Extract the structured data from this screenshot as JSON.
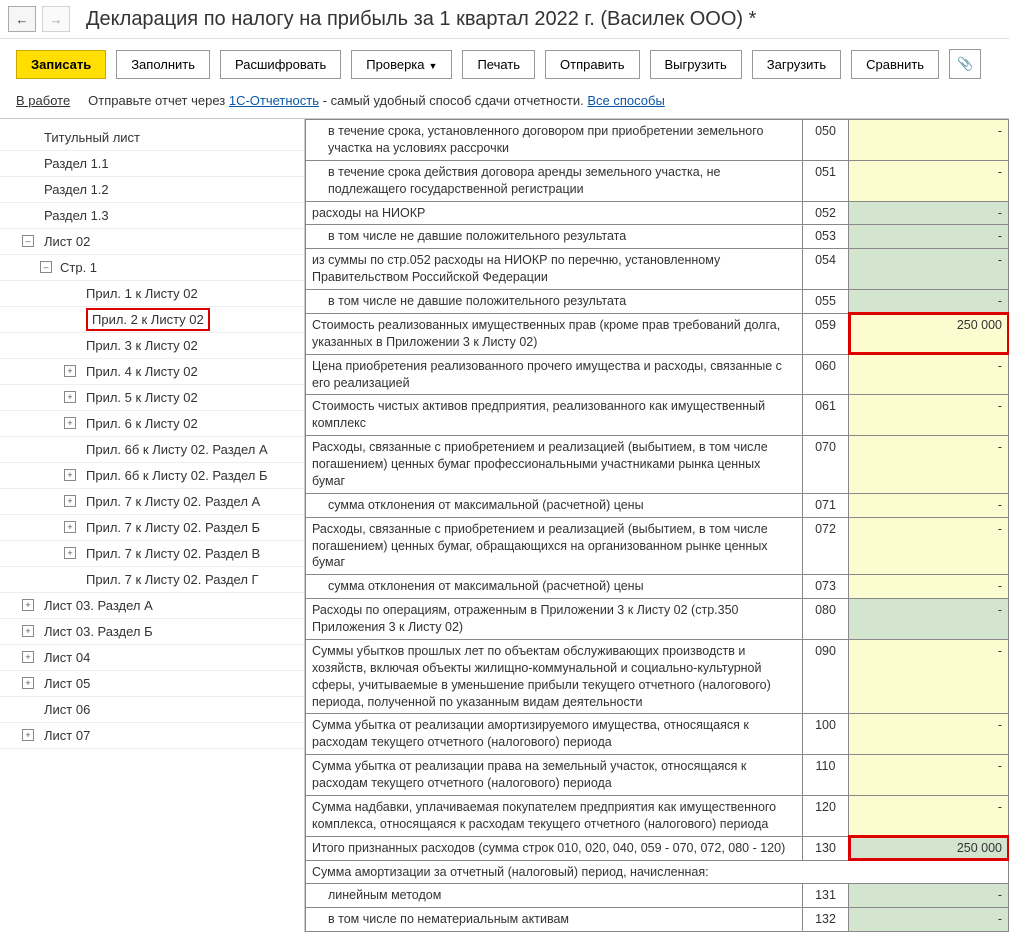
{
  "header": {
    "title": "Декларация по налогу на прибыль за 1 квартал 2022 г. (Василек ООО) *"
  },
  "toolbar": {
    "save": "Записать",
    "fill": "Заполнить",
    "decode": "Расшифровать",
    "check": "Проверка",
    "print": "Печать",
    "send": "Отправить",
    "upload": "Выгрузить",
    "download": "Загрузить",
    "compare": "Сравнить"
  },
  "status": {
    "label": "В работе",
    "text1": "Отправьте отчет через ",
    "link1": "1С-Отчетность",
    "text2": " - самый удобный способ сдачи отчетности. ",
    "link2": "Все способы"
  },
  "tree": [
    {
      "lvl": 0,
      "label": "Титульный лист",
      "exp": ""
    },
    {
      "lvl": 0,
      "label": "Раздел 1.1",
      "exp": ""
    },
    {
      "lvl": 0,
      "label": "Раздел 1.2",
      "exp": ""
    },
    {
      "lvl": 0,
      "label": "Раздел 1.3",
      "exp": ""
    },
    {
      "lvl": 0,
      "label": "Лист 02",
      "exp": "–"
    },
    {
      "lvl": 1,
      "label": "Стр. 1",
      "exp": "–"
    },
    {
      "lvl": 2,
      "label": "Прил. 1 к Листу 02",
      "exp": ""
    },
    {
      "lvl": 2,
      "label": "Прил. 2 к Листу 02",
      "exp": "",
      "hl": true
    },
    {
      "lvl": 2,
      "label": "Прил. 3 к Листу 02",
      "exp": ""
    },
    {
      "lvl": 2,
      "label": "Прил. 4 к Листу 02",
      "exp": "+"
    },
    {
      "lvl": 2,
      "label": "Прил. 5 к Листу 02",
      "exp": "+"
    },
    {
      "lvl": 2,
      "label": "Прил. 6 к Листу 02",
      "exp": "+"
    },
    {
      "lvl": 2,
      "label": "Прил. 6б к Листу 02. Раздел А",
      "exp": ""
    },
    {
      "lvl": 2,
      "label": "Прил. 6б к Листу 02. Раздел Б",
      "exp": "+"
    },
    {
      "lvl": 2,
      "label": "Прил. 7 к Листу 02. Раздел А",
      "exp": "+"
    },
    {
      "lvl": 2,
      "label": "Прил. 7 к Листу 02. Раздел Б",
      "exp": "+"
    },
    {
      "lvl": 2,
      "label": "Прил. 7 к Листу 02. Раздел В",
      "exp": "+"
    },
    {
      "lvl": 2,
      "label": "Прил. 7 к Листу 02. Раздел Г",
      "exp": ""
    },
    {
      "lvl": 0,
      "label": "Лист 03. Раздел А",
      "exp": "+"
    },
    {
      "lvl": 0,
      "label": "Лист 03. Раздел Б",
      "exp": "+"
    },
    {
      "lvl": 0,
      "label": "Лист 04",
      "exp": "+"
    },
    {
      "lvl": 0,
      "label": "Лист 05",
      "exp": "+"
    },
    {
      "lvl": 0,
      "label": "Лист 06",
      "exp": ""
    },
    {
      "lvl": 0,
      "label": "Лист 07",
      "exp": "+"
    }
  ],
  "rows": [
    {
      "desc": "в течение срока, установленного договором при приобретении земельного участка на условиях рассрочки",
      "indent": 1,
      "code": "050",
      "val": "-",
      "cls": "cell-yellow"
    },
    {
      "desc": "в течение срока действия договора аренды земельного участка, не подлежащего государственной регистрации",
      "indent": 1,
      "code": "051",
      "val": "-",
      "cls": "cell-yellow"
    },
    {
      "desc": "расходы на НИОКР",
      "indent": 0,
      "code": "052",
      "val": "-",
      "cls": "cell-green"
    },
    {
      "desc": "в том числе не давшие положительного результата",
      "indent": 1,
      "code": "053",
      "val": "-",
      "cls": "cell-green"
    },
    {
      "desc": "из суммы по стр.052 расходы на НИОКР по перечню, установленному Правительством Российской Федерации",
      "indent": 0,
      "code": "054",
      "val": "-",
      "cls": "cell-green"
    },
    {
      "desc": "в том числе не давшие положительного результата",
      "indent": 1,
      "code": "055",
      "val": "-",
      "cls": "cell-green"
    },
    {
      "desc": "Стоимость реализованных имущественных прав (кроме прав требований долга, указанных в Приложении 3 к Листу 02)",
      "indent": 0,
      "code": "059",
      "val": "250 000",
      "cls": "cell-yellow",
      "hl": true
    },
    {
      "desc": "Цена приобретения реализованного прочего имущества и расходы, связанные с его реализацией",
      "indent": 0,
      "code": "060",
      "val": "-",
      "cls": "cell-yellow"
    },
    {
      "desc": "Стоимость чистых активов предприятия, реализованного как имущественный комплекс",
      "indent": 0,
      "code": "061",
      "val": "-",
      "cls": "cell-yellow"
    },
    {
      "desc": "Расходы, связанные с приобретением и реализацией (выбытием, в том числе погашением) ценных бумаг профессиональными участниками рынка ценных бумаг",
      "indent": 0,
      "code": "070",
      "val": "-",
      "cls": "cell-yellow"
    },
    {
      "desc": "сумма отклонения от максимальной (расчетной) цены",
      "indent": 1,
      "code": "071",
      "val": "-",
      "cls": "cell-yellow"
    },
    {
      "desc": "Расходы, связанные с приобретением и реализацией (выбытием, в том числе погашением) ценных бумаг, обращающихся на организованном рынке ценных бумаг",
      "indent": 0,
      "code": "072",
      "val": "-",
      "cls": "cell-yellow"
    },
    {
      "desc": "сумма отклонения от максимальной (расчетной) цены",
      "indent": 1,
      "code": "073",
      "val": "-",
      "cls": "cell-yellow"
    },
    {
      "desc": "Расходы по операциям, отраженным в Приложении 3 к Листу 02 (стр.350 Приложения 3 к Листу 02)",
      "indent": 0,
      "code": "080",
      "val": "-",
      "cls": "cell-green"
    },
    {
      "desc": "Суммы убытков прошлых лет по объектам обслуживающих производств и хозяйств, включая объекты жилищно-коммунальной и социально-культурной сферы, учитываемые в уменьшение прибыли текущего отчетного (налогового) периода, полученной по указанным видам деятельности",
      "indent": 0,
      "code": "090",
      "val": "-",
      "cls": "cell-yellow"
    },
    {
      "desc": "Сумма убытка от реализации амортизируемого имущества, относящаяся к расходам текущего отчетного (налогового) периода",
      "indent": 0,
      "code": "100",
      "val": "-",
      "cls": "cell-yellow"
    },
    {
      "desc": "Сумма убытка от реализации права на земельный участок, относящаяся к расходам текущего отчетного (налогового) периода",
      "indent": 0,
      "code": "110",
      "val": "-",
      "cls": "cell-yellow"
    },
    {
      "desc": "Сумма надбавки, уплачиваемая покупателем предприятия как имущественного комплекса, относящаяся к расходам текущего отчетного (налогового) периода",
      "indent": 0,
      "code": "120",
      "val": "-",
      "cls": "cell-yellow"
    },
    {
      "desc": "Итого признанных расходов (сумма строк 010, 020, 040, 059 - 070, 072, 080 - 120)",
      "indent": 0,
      "code": "130",
      "val": "250 000",
      "cls": "cell-green",
      "hl": true
    },
    {
      "desc": "Сумма амортизации за отчетный (налоговый) период, начисленная:",
      "indent": 0,
      "code": "",
      "val": "",
      "noval": true
    },
    {
      "desc": "линейным методом",
      "indent": 1,
      "code": "131",
      "val": "-",
      "cls": "cell-green"
    },
    {
      "desc": "в том числе по нематериальным активам",
      "indent": 1,
      "code": "132",
      "val": "-",
      "cls": "cell-green"
    }
  ]
}
